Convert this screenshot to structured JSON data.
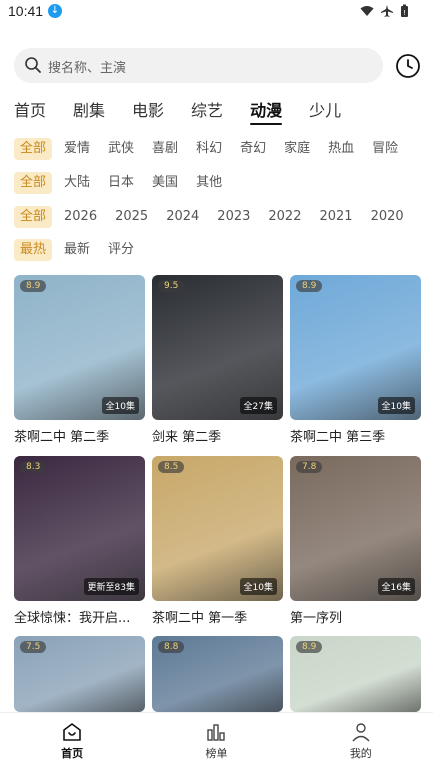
{
  "status": {
    "time": "10:41"
  },
  "search": {
    "placeholder": "搜名称、主演"
  },
  "tabs": [
    "首页",
    "剧集",
    "电影",
    "综艺",
    "动漫",
    "少儿"
  ],
  "active_tab": "动漫",
  "filters": {
    "genre": [
      "全部",
      "爱情",
      "武侠",
      "喜剧",
      "科幻",
      "奇幻",
      "家庭",
      "热血",
      "冒险"
    ],
    "region": [
      "全部",
      "大陆",
      "日本",
      "美国",
      "其他"
    ],
    "year": [
      "全部",
      "2026",
      "2025",
      "2024",
      "2023",
      "2022",
      "2021",
      "2020"
    ],
    "sort": [
      "最热",
      "最新",
      "评分"
    ]
  },
  "cards": [
    {
      "title": "茶啊二中 第二季",
      "rating": "8.9",
      "episodes": "全10集",
      "color": "#8fb3c9"
    },
    {
      "title": "剑来 第二季",
      "rating": "9.5",
      "episodes": "全27集",
      "color": "#2a2d33"
    },
    {
      "title": "茶啊二中 第三季",
      "rating": "8.9",
      "episodes": "全10集",
      "color": "#6fa9d8"
    },
    {
      "title": "全球惊悚：我开启...",
      "rating": "8.3",
      "episodes": "更新至83集",
      "color": "#3a2840"
    },
    {
      "title": "茶啊二中 第一季",
      "rating": "8.5",
      "episodes": "全10集",
      "color": "#c8a86a"
    },
    {
      "title": "第一序列",
      "rating": "7.8",
      "episodes": "全16集",
      "color": "#7a6a5e"
    },
    {
      "title": "",
      "rating": "7.5",
      "episodes": "",
      "color": "#8aa2b8"
    },
    {
      "title": "",
      "rating": "8.8",
      "episodes": "",
      "color": "#5e7a96"
    },
    {
      "title": "",
      "rating": "8.9",
      "episodes": "",
      "color": "#c9d6c8"
    }
  ],
  "bottom_nav": [
    {
      "label": "首页",
      "icon": "home-icon"
    },
    {
      "label": "榜单",
      "icon": "chart-icon"
    },
    {
      "label": "我的",
      "icon": "user-icon"
    }
  ],
  "colors": {
    "chip_selected_bg": "#fbeac6",
    "chip_selected_text": "#c98a1f",
    "download_badge": "#1e9bf0"
  }
}
